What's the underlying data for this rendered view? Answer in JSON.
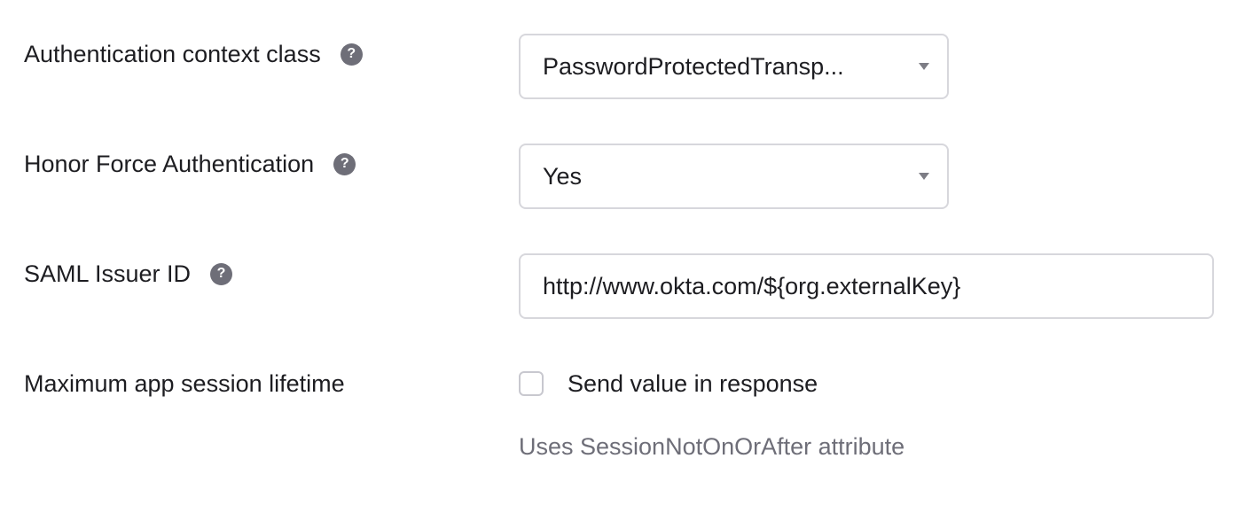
{
  "fields": {
    "auth_context": {
      "label": "Authentication context class",
      "value": "PasswordProtectedTransp..."
    },
    "force_auth": {
      "label": "Honor Force Authentication",
      "value": "Yes"
    },
    "issuer_id": {
      "label": "SAML Issuer ID",
      "value": "http://www.okta.com/${org.externalKey}"
    },
    "session_lifetime": {
      "label": "Maximum app session lifetime",
      "checkbox_label": "Send value in response",
      "checked": false,
      "hint": "Uses SessionNotOnOrAfter attribute"
    }
  },
  "icons": {
    "help": "?"
  },
  "colors": {
    "text": "#1d1d21",
    "muted": "#6e6e78",
    "border": "#d7d7dc",
    "help_icon_bg": "#6e6e78"
  }
}
